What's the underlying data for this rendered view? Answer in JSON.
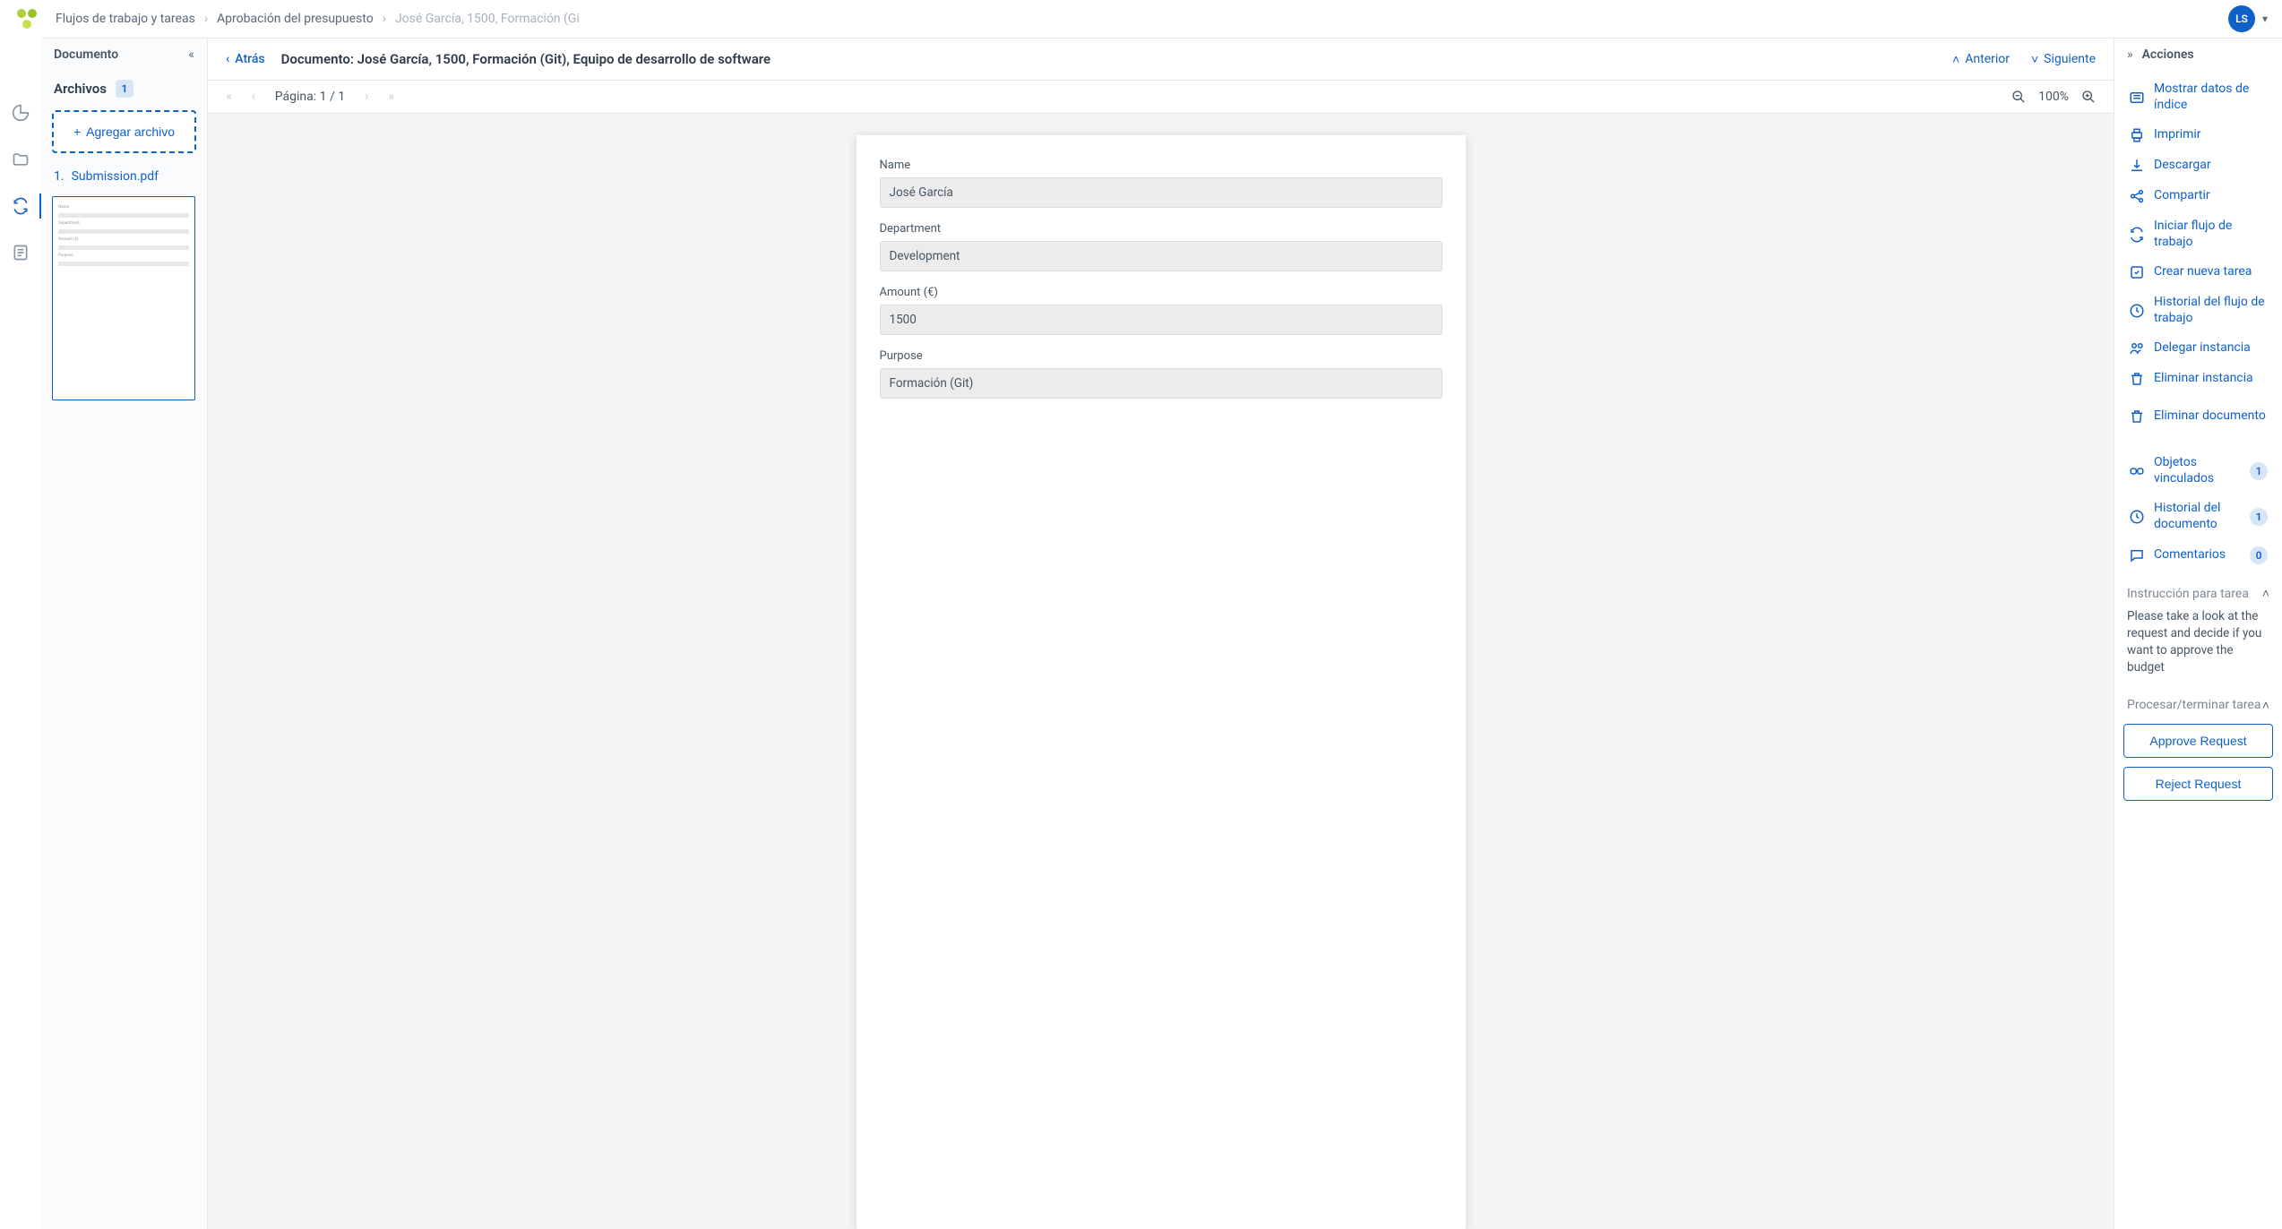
{
  "breadcrumb": {
    "items": [
      "Flujos de trabajo y tareas",
      "Aprobación del presupuesto",
      "José García, 1500, Formación (Gi"
    ]
  },
  "avatar": {
    "initials": "LS"
  },
  "leftPanel": {
    "title": "Documento",
    "filesLabel": "Archivos",
    "filesCount": "1",
    "addFile": "Agregar archivo",
    "file": {
      "index": "1.",
      "name": "Submission.pdf"
    }
  },
  "docHeader": {
    "back": "Atrás",
    "title": "Documento: José García, 1500, Formación (Git), Equipo de desarrollo de software",
    "prev": "Anterior",
    "next": "Siguiente"
  },
  "pageBar": {
    "pageLabel": "Página: 1 / 1",
    "zoom": "100%"
  },
  "form": {
    "fields": [
      {
        "label": "Name",
        "value": "José García"
      },
      {
        "label": "Department",
        "value": "Development"
      },
      {
        "label": "Amount (€)",
        "value": "1500"
      },
      {
        "label": "Purpose",
        "value": "Formación (Git)"
      }
    ]
  },
  "rightPanel": {
    "title": "Acciones",
    "actions": {
      "showIndex": "Mostrar datos de índice",
      "print": "Imprimir",
      "download": "Descargar",
      "share": "Compartir",
      "startWorkflow": "Iniciar flujo de trabajo",
      "newTask": "Crear nueva tarea",
      "workflowHistory": "Historial del flujo de trabajo",
      "delegate": "Delegar instancia",
      "deleteInstance": "Eliminar instancia",
      "deleteDocument": "Eliminar documento",
      "linkedObjects": {
        "label": "Objetos vinculados",
        "badge": "1"
      },
      "docHistory": {
        "label": "Historial del documento",
        "badge": "1"
      },
      "comments": {
        "label": "Comentarios",
        "badge": "0"
      }
    },
    "instructionTitle": "Instrucción para tarea",
    "instructionText": "Please take a look at the request and decide if you want to approve the budget",
    "processTitle": "Procesar/terminar tarea",
    "approve": "Approve Request",
    "reject": "Reject Request"
  }
}
